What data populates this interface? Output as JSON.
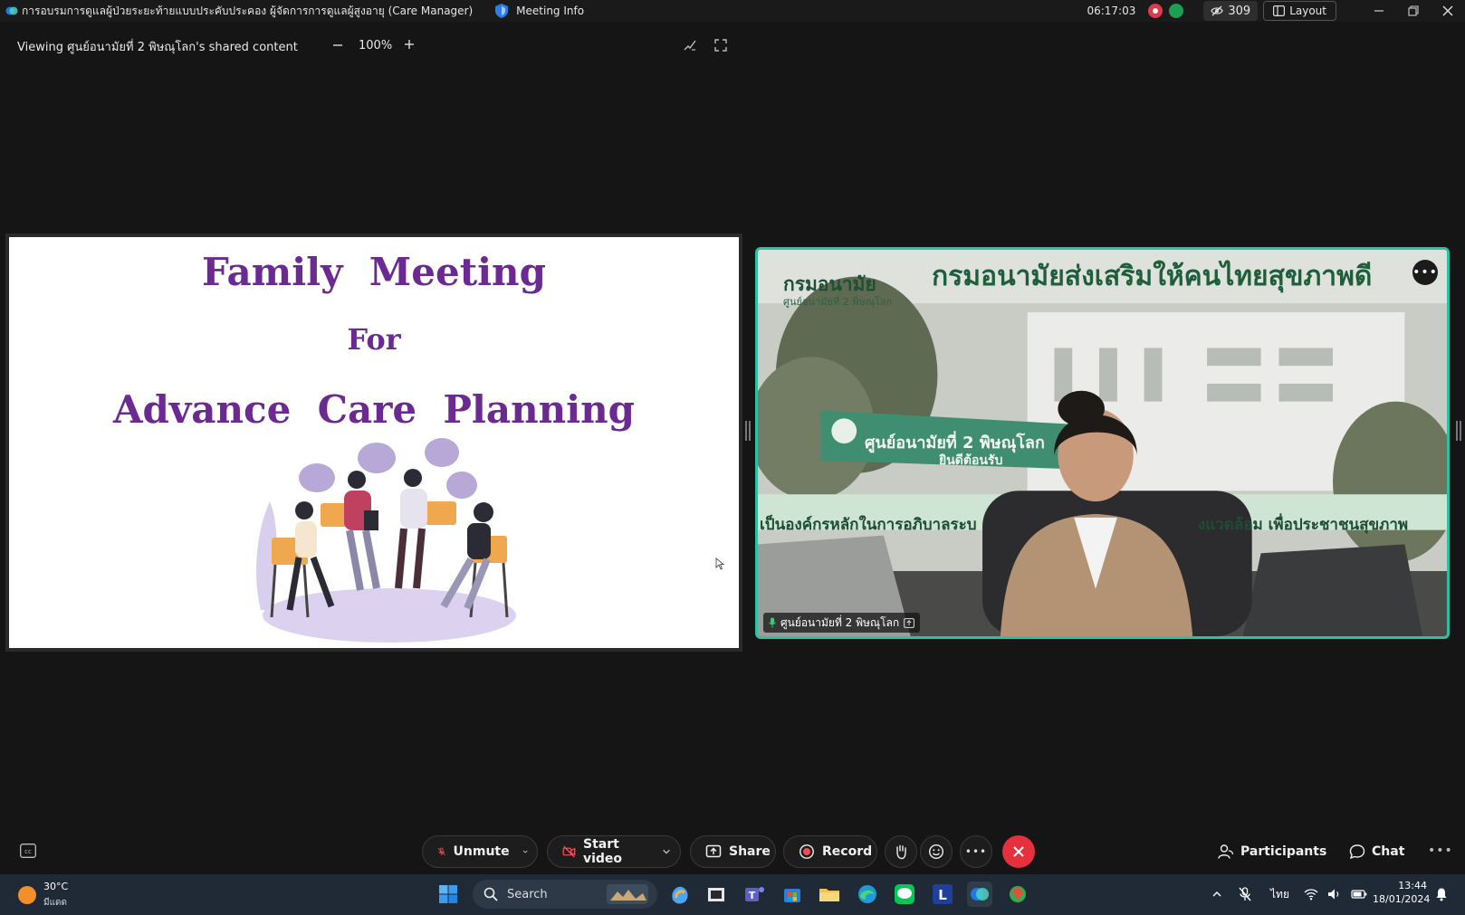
{
  "titlebar": {
    "window_title": "การอบรมการดูแลผู้ป่วยระยะท้ายแบบประคับประคอง ผู้จัดการการดูแลผู้สูงอายุ (Care Manager)",
    "meeting_info": "Meeting Info",
    "elapsed_time": "06:17:03",
    "participant_count": "309",
    "layout_label": "Layout"
  },
  "viewbar": {
    "viewing_text": "Viewing ศูนย์อนามัยที่ 2 พิษณุโลก's shared content",
    "zoom_value": "100%"
  },
  "slide": {
    "line1": "Family  Meeting",
    "line2": "For",
    "line3": "Advance  Care  Planning",
    "accent_color": "#6b2a91"
  },
  "video": {
    "banner_text": "กรมอนามัยส่งเสริมให้คนไทยสุขภาพดี",
    "logo_text": "กรมอนามัย",
    "logo_sub": "ศูนย์อนามัยที่ 2 พิษณุโลก",
    "sign_text": "ศูนย์อนามัยที่ 2 พิษณุโลก",
    "sign_text2": "ยินดีต้อนรับ",
    "wall_text": "เป็นองค์กรหลักในการอภิบาลระบ",
    "wall_text2": "งแวดล้อม เพื่อประชาชนสุขภาพ",
    "participant_name": "ศูนย์อนามัยที่ 2 พิษณุโลก",
    "highlight_color": "#2fc0a4"
  },
  "controls": {
    "unmute_label": "Unmute",
    "start_video_label": "Start video",
    "share_label": "Share",
    "record_label": "Record",
    "participants_label": "Participants",
    "chat_label": "Chat",
    "end_color": "#e5303d"
  },
  "taskbar": {
    "temperature": "30°C",
    "condition": "มีแดด",
    "search_label": "Search",
    "language": "ไทย",
    "time": "13:44",
    "date": "18/01/2024"
  }
}
